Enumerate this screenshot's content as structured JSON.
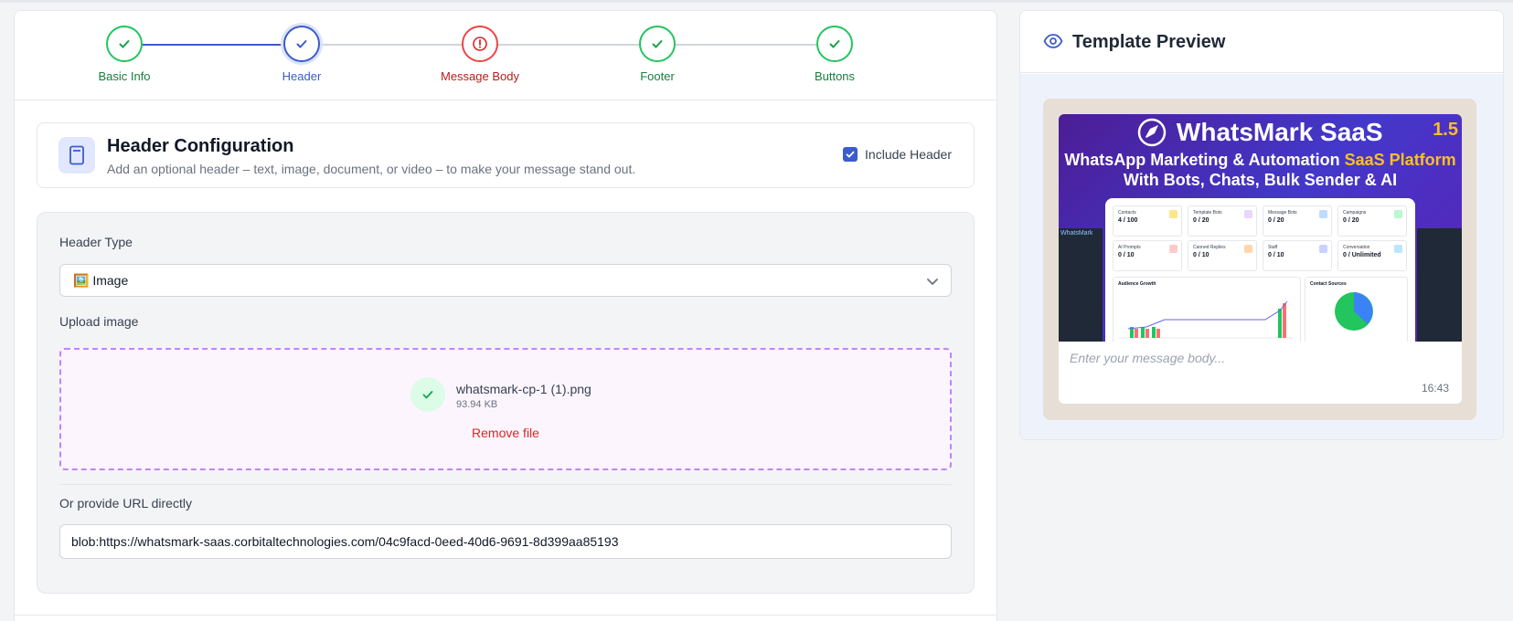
{
  "stepper": {
    "steps": [
      {
        "label": "Basic Info",
        "status": "complete",
        "color": "#16a34a"
      },
      {
        "label": "Header",
        "status": "active",
        "color": "#3b5ccc"
      },
      {
        "label": "Message Body",
        "status": "error",
        "color": "#dc2626"
      },
      {
        "label": "Footer",
        "status": "complete",
        "color": "#16a34a"
      },
      {
        "label": "Buttons",
        "status": "complete",
        "color": "#16a34a"
      }
    ]
  },
  "config": {
    "title": "Header Configuration",
    "description": "Add an optional header – text, image, document, or video – to make your message stand out.",
    "include_label": "Include Header",
    "include_checked": true
  },
  "form": {
    "header_type_label": "Header Type",
    "header_type_value": "🖼️ Image",
    "upload_label": "Upload image",
    "file_name": "whatsmark-cp-1 (1).png",
    "file_size": "93.94 KB",
    "remove_label": "Remove file",
    "url_label": "Or provide URL directly",
    "url_value": "blob:https://whatsmark-saas.corbitaltechnologies.com/04c9facd-0eed-40d6-9691-8d399aa85193"
  },
  "preview": {
    "title": "Template Preview",
    "promo": {
      "brand": "WhatsMark SaaS",
      "version": "1.5",
      "line1_a": "WhatsApp Marketing & Automation ",
      "line1_b": "SaaS Platform",
      "line2": "With Bots, Chats, Bulk Sender & AI",
      "sidebar_brand": "WhatsMark",
      "stats": [
        {
          "title": "Contacts",
          "value": "4 / 100",
          "color": "#fde68a"
        },
        {
          "title": "Template Bots",
          "value": "0 / 20",
          "color": "#e9d5ff"
        },
        {
          "title": "Message Bots",
          "value": "0 / 20",
          "color": "#bfdbfe"
        },
        {
          "title": "Campaigns",
          "value": "0 / 20",
          "color": "#bbf7d0"
        },
        {
          "title": "AI Prompts",
          "value": "0 / 10",
          "color": "#fecaca"
        },
        {
          "title": "Canned Replies",
          "value": "0 / 10",
          "color": "#fed7aa"
        },
        {
          "title": "Staff",
          "value": "0 / 10",
          "color": "#c7d2fe"
        },
        {
          "title": "Conversation",
          "value": "0 / Unlimited",
          "color": "#bae6fd"
        }
      ],
      "panel1_title": "Audience Growth",
      "panel2_title": "Contact Sources"
    },
    "message_placeholder": "Enter your message body...",
    "time": "16:43"
  }
}
